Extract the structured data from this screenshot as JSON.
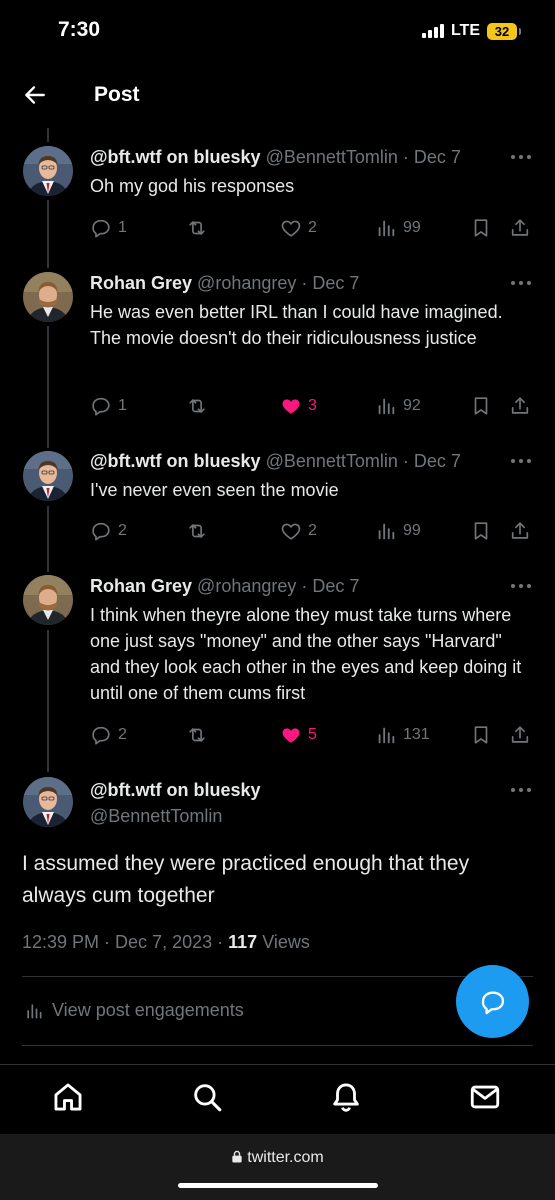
{
  "status_bar": {
    "time": "7:30",
    "network": "LTE",
    "battery": "32"
  },
  "header": {
    "title": "Post",
    "back_icon": "arrow-left-icon"
  },
  "thread": [
    {
      "name": "@bft.wtf on bluesky",
      "handle": "@BennettTomlin",
      "date": "Dec 7",
      "text": "Oh my god his responses",
      "replies": "1",
      "likes": "2",
      "liked": false,
      "views": "99"
    },
    {
      "name": "Rohan Grey",
      "handle": "@rohangrey",
      "date": "Dec 7",
      "text": "He was even better IRL than I could have imagined. The movie doesn't do their ridiculousness justice",
      "replies": "1",
      "likes": "3",
      "liked": true,
      "views": "92"
    },
    {
      "name": "@bft.wtf on bluesky",
      "handle": "@BennettTomlin",
      "date": "Dec 7",
      "text": "I've never even seen the movie",
      "replies": "2",
      "likes": "2",
      "liked": false,
      "views": "99"
    },
    {
      "name": "Rohan Grey",
      "handle": "@rohangrey",
      "date": "Dec 7",
      "text": "I think when theyre alone they must take turns where one just says \"money\" and the other says \"Harvard\" and they look each other in the eyes and keep doing it until one of them cums first",
      "replies": "2",
      "likes": "5",
      "liked": true,
      "views": "131"
    }
  ],
  "main_post": {
    "name": "@bft.wtf on bluesky",
    "handle": "@BennettTomlin",
    "text": "I assumed they were practiced enough that they always cum together",
    "time": "12:39 PM",
    "date": "Dec 7, 2023",
    "views_count": "117",
    "views_label": "Views"
  },
  "engagements_label": "View post engagements",
  "browser": {
    "url": "twitter.com"
  },
  "colors": {
    "like": "#f91880",
    "accent": "#1d9bf0",
    "muted": "#71767b"
  }
}
